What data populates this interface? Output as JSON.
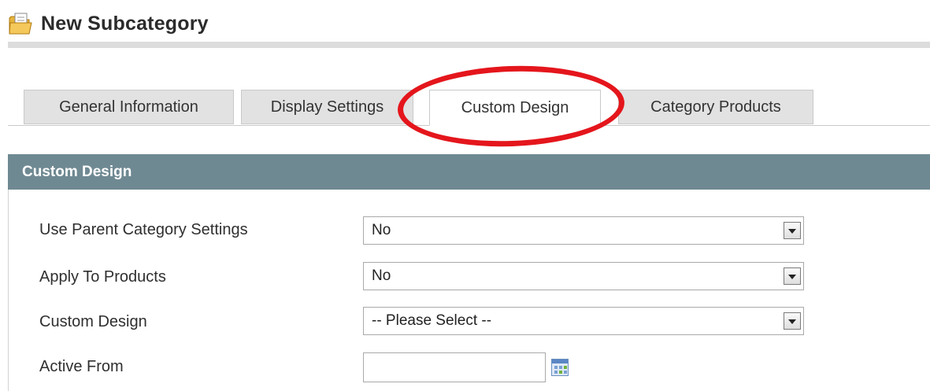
{
  "header": {
    "title": "New Subcategory",
    "icon": "folder-new-icon"
  },
  "tabs": [
    {
      "label": "General Information",
      "active": false
    },
    {
      "label": "Display Settings",
      "active": false
    },
    {
      "label": "Custom Design",
      "active": true
    },
    {
      "label": "Category Products",
      "active": false
    }
  ],
  "highlight": {
    "color": "#e4161c"
  },
  "section": {
    "title": "Custom Design",
    "header_color": "#6f8992"
  },
  "form": {
    "use_parent": {
      "label": "Use Parent Category Settings",
      "value": "No"
    },
    "apply_products": {
      "label": "Apply To Products",
      "value": "No"
    },
    "custom_design": {
      "label": "Custom Design",
      "value": "-- Please Select --"
    },
    "active_from": {
      "label": "Active From",
      "value": "",
      "icon": "calendar-icon"
    }
  }
}
